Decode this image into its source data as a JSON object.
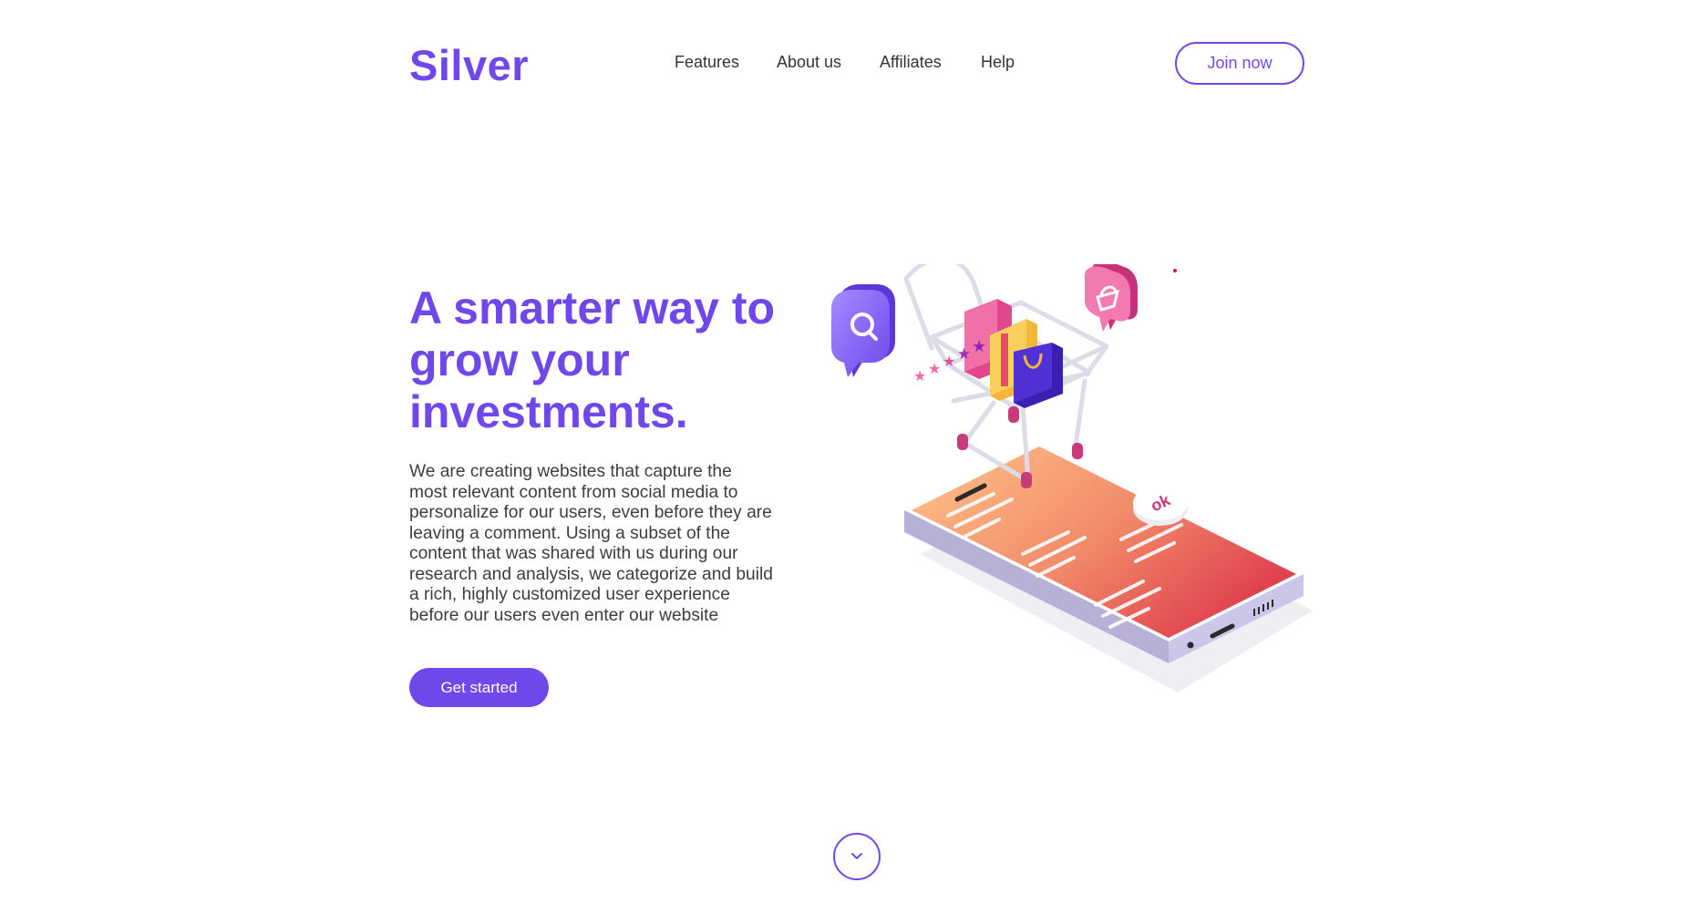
{
  "header": {
    "logo": "Silver",
    "nav": [
      "Features",
      "About us",
      "Affiliates",
      "Help"
    ],
    "join_label": "Join now"
  },
  "hero": {
    "title": "A smarter way to grow your investments.",
    "description": "We are creating websites that capture the most relevant content from social media to personalize for our users, even before they are leaving a comment. Using a subset of the content that was shared with us during our research and analysis, we categorize and build a rich, highly customized user experience before our users even enter our website",
    "cta_label": "Get started",
    "illustration": {
      "ok_text": "ok",
      "icons": [
        "search-bubble-icon",
        "basket-bubble-icon",
        "shopping-cart-icon",
        "shopping-bag-icon",
        "star-rating-icon"
      ]
    }
  },
  "scroll": {
    "icon": "chevron-down-icon"
  },
  "colors": {
    "brand": "#7047eb",
    "text": "#3d3d3d",
    "background": "#ffffff"
  }
}
